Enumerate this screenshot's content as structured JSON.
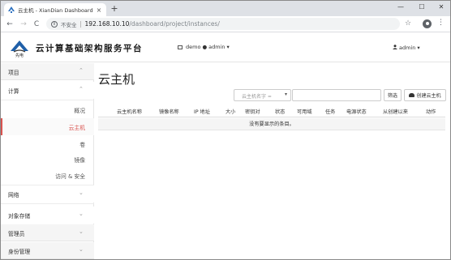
{
  "browser": {
    "tab_title": "云主机 - XianDian Dashboard",
    "tab_close": "×",
    "new_tab": "+",
    "win_min": "—",
    "win_max": "☐",
    "win_close": "✕",
    "back": "←",
    "forward": "→",
    "reload": "C",
    "security_label": "不安全",
    "url_host": "192.168.10.10",
    "url_path": "/dashboard/project/instances/",
    "star": "☆",
    "menu": "⋮"
  },
  "header": {
    "logo_text": "先电",
    "brand": "云计算基础架构服务平台",
    "project": "demo",
    "context_user": "admin",
    "user": "admin",
    "caret": "▾"
  },
  "sidebar": {
    "project_label": "项目",
    "compute_label": "计算",
    "compute_items": [
      "概况",
      "云主机",
      "卷",
      "镜像",
      "访问 & 安全"
    ],
    "network_label": "网络",
    "object_storage_label": "对象存储",
    "admin_label": "管理员",
    "identity_label": "身份管理",
    "chev_up": "⌃",
    "chev_down": "⌄"
  },
  "main": {
    "title": "云主机",
    "filter_select": "云主机名字 =",
    "filter_caret": "▾",
    "filter_button": "筛选",
    "create_button": "创建云主机",
    "columns": [
      "云主机名称",
      "镜像名称",
      "IP 地址",
      "大小",
      "密钥对",
      "状态",
      "可用域",
      "任务",
      "电源状态",
      "从创建以来",
      "动作"
    ],
    "empty_text": "没有要显示的条目。"
  },
  "colors": {
    "accent_red": "#d9534f",
    "sidebar_panel_bg": "#f5f5f5"
  }
}
